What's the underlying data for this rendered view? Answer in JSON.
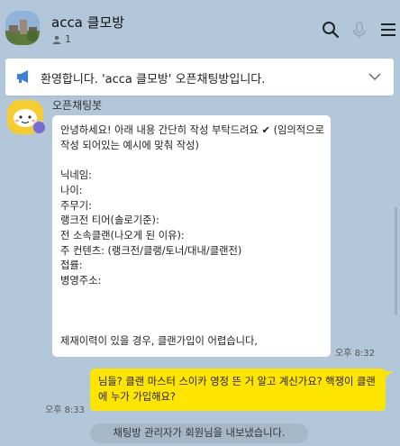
{
  "header": {
    "room_title": "acca 클모방",
    "member_count": "1",
    "icons": [
      "search-icon",
      "microphone-icon",
      "menu-icon"
    ]
  },
  "notice": {
    "icon": "megaphone-icon",
    "text": "환영합니다. 'acca 클모방' 오픈채팅방입니다.",
    "expand_icon": "chevron-down-icon"
  },
  "messages": {
    "incoming": {
      "sender": "오픈채팅봇",
      "text": "안녕하세요! 아래 내용 간단히 작성 부탁드려요 ✔ (임의적으로 작성 되어있는 예시에 맞춰 작성)\n\n닉네임:\n나이:\n주무기:\n랭크전 티어(솔로기준):\n전 소속클랜(나오게 된 이유):\n주 컨텐츠: (랭크전/클랭/토너/대내/클랜전)\n접률:\n병영주소:\n\n\n\n제재이력이 있을 경우, 클랜가입이 어렵습니다,",
      "time": "오후 8:32"
    },
    "outgoing": {
      "text": "님들? 클랜 마스터 스이카 영정 뜬 거 알고 계신가요? 핵쟁이 클랜에 누가 가입해요?",
      "time": "오후 8:33"
    },
    "system": {
      "text": "채팅방 관리자가 회원님을 내보냈습니다."
    }
  },
  "colors": {
    "background": "#b2c7da",
    "outgoing_bubble": "#fee500",
    "incoming_bubble": "#ffffff",
    "bot_avatar": "#f7cc2f",
    "notice_icon": "#3b82d6"
  }
}
